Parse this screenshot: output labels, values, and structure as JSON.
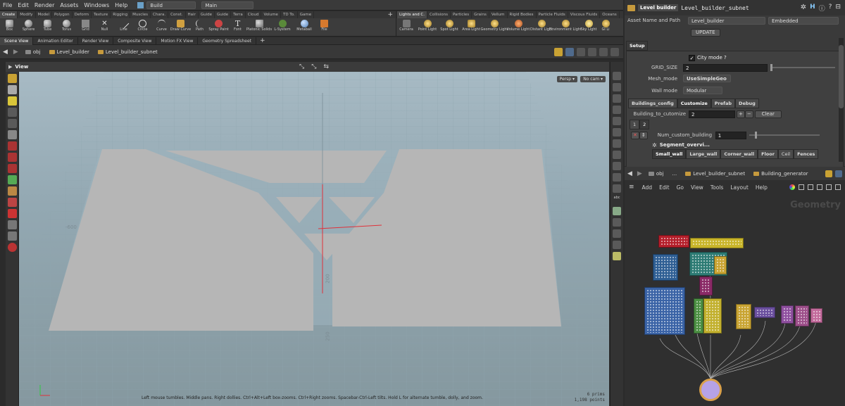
{
  "menubar": {
    "items": [
      "File",
      "Edit",
      "Render",
      "Assets",
      "Windows",
      "Help"
    ],
    "desktop": "Build",
    "context": "Main"
  },
  "shelf_tabs": [
    "Create",
    "Modify",
    "Model",
    "Polygon",
    "Deform",
    "Texture",
    "Rigging",
    "Muscles",
    "Chara.",
    "Const.",
    "Hair",
    "Guide",
    "Guide",
    "Terra",
    "Cloud",
    "Volume",
    "TD To.",
    "Game"
  ],
  "shelf_tabs2": [
    "Lights and C.",
    "Collisions",
    "Particles",
    "Grains",
    "Vellum",
    "Rigid Bodies",
    "Particle Fluids",
    "Viscous Fluids",
    "Oceans"
  ],
  "shelf_tools": [
    "Box",
    "Sphere",
    "Tube",
    "Torus",
    "Grid",
    "Null",
    "Line",
    "Circle",
    "Curve",
    "Draw Curve",
    "Path",
    "Spray Paint",
    "Font",
    "Platonic Solids",
    "L-System",
    "Metaball",
    "File"
  ],
  "light_tools": [
    "Camera",
    "Point Light",
    "Spot Light",
    "Area Light",
    "Geometry Light",
    "Volume Light",
    "Distant Light",
    "Environment Light",
    "Sky Light",
    "GI Li"
  ],
  "pane_tabs": [
    "Scene View",
    "Animation Editor",
    "Render View",
    "Composite View",
    "Motion FX View",
    "Geometry Spreadsheet"
  ],
  "path": {
    "root": "obj",
    "items": [
      "Level_builder",
      "Level_builder_subnet"
    ]
  },
  "viewport": {
    "title": "View",
    "persp": "Persp",
    "cam": "No cam",
    "label_left": "-600",
    "label_top": "200",
    "label_bottom": "250",
    "status": "Left mouse tumbles. Middle pans. Right dollies. Ctrl+Alt+Left box-zooms. Ctrl+Right zooms. Spacebar-Ctrl-Left tilts. Hold L for alternate tumble, dolly, and zoom.",
    "prims": "6  prims",
    "points": "1,198 points"
  },
  "panel": {
    "node_type": "Level builder",
    "node_name": "Level_builder_subnet",
    "asset_label": "Asset Name and Path",
    "asset_value": "Level_builder",
    "embed_value": "Embedded",
    "update_label": "UPDATE",
    "setup_tab": "Setup",
    "city_mode_label": "City mode ?",
    "grid_size_label": "GRID_SIZE",
    "grid_size_value": "2",
    "mesh_mode_label": "Mesh_mode",
    "mesh_mode_value": "UseSimpleGeo",
    "wall_mode_label": "Wall mode",
    "wall_mode_value": "Modular",
    "subtabs": [
      "Buildings_config",
      "Customize",
      "Prefab",
      "Debug"
    ],
    "building_label": "Building_to_cutomize",
    "building_value": "2",
    "clear_label": "Clear",
    "index_tabs": [
      "1",
      "2"
    ],
    "num_custom_label": "Num_custom_building",
    "num_custom_value": "1",
    "segment_label": "Segment_overvi...",
    "wall_tabs": [
      "Small_wall",
      "Large_wall",
      "Corner_wall",
      "Floor",
      "Ceil",
      "Fences"
    ]
  },
  "network": {
    "path": [
      "obj",
      "...",
      "Level_builder_subnet",
      "Building_generator"
    ],
    "menu": [
      "Add",
      "Edit",
      "Go",
      "View",
      "Tools",
      "Layout",
      "Help"
    ],
    "context_label": "Geometry",
    "node_colors": [
      "#b51f2b",
      "#c9b52a",
      "#2f5f94",
      "#2d7b74",
      "#c9a433",
      "#8a2a66",
      "#c2b02e",
      "#4c8f43",
      "#3a63a6",
      "#6a4f9e",
      "#8e4f9e",
      "#9d4f8a",
      "#c26a9b",
      "#b6a2e6"
    ]
  }
}
